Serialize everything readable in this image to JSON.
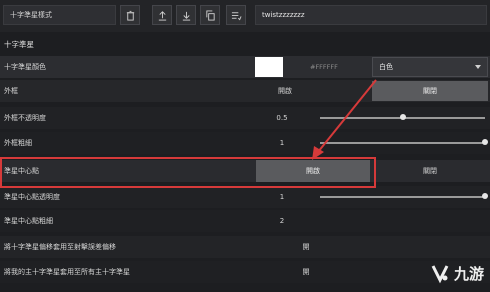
{
  "toolbar": {
    "style_label": "十字準星樣式",
    "crosshair_name": "twistzzzzzzz",
    "icons": [
      "trash-icon",
      "upload-icon",
      "download-icon",
      "copy-icon",
      "paste-icon"
    ]
  },
  "section_title": "十字準星",
  "rows": {
    "color": {
      "label": "十字準星顏色",
      "hex": "#FFFFFF",
      "dropdown_value": "白色",
      "swatch": "#ffffff"
    },
    "outline": {
      "label": "外框",
      "on": "開啟",
      "off": "關閉",
      "selected": "off"
    },
    "outline_opacity": {
      "label": "外框不透明度",
      "value": "0.5",
      "fraction": 0.5
    },
    "outline_thickness": {
      "label": "外框粗細",
      "value": "1",
      "fraction": 1.0
    },
    "center_dot": {
      "label": "準星中心點",
      "on": "開啟",
      "off": "關閉",
      "selected": "on"
    },
    "center_dot_opacity": {
      "label": "準星中心點透明度",
      "value": "1",
      "fraction": 1.0
    },
    "center_dot_thickness": {
      "label": "準星中心點粗細",
      "value": "2"
    },
    "firing_error": {
      "label": "將十字準星偏移套用至射擊誤差偏移",
      "partial": "開"
    },
    "apply_all": {
      "label": "將我的主十字準星套用至所有主十字準星",
      "partial": "開"
    }
  },
  "watermark": {
    "text": "九游"
  },
  "colors": {
    "highlight": "#d63a3a",
    "arrow": "#d63a3a"
  }
}
